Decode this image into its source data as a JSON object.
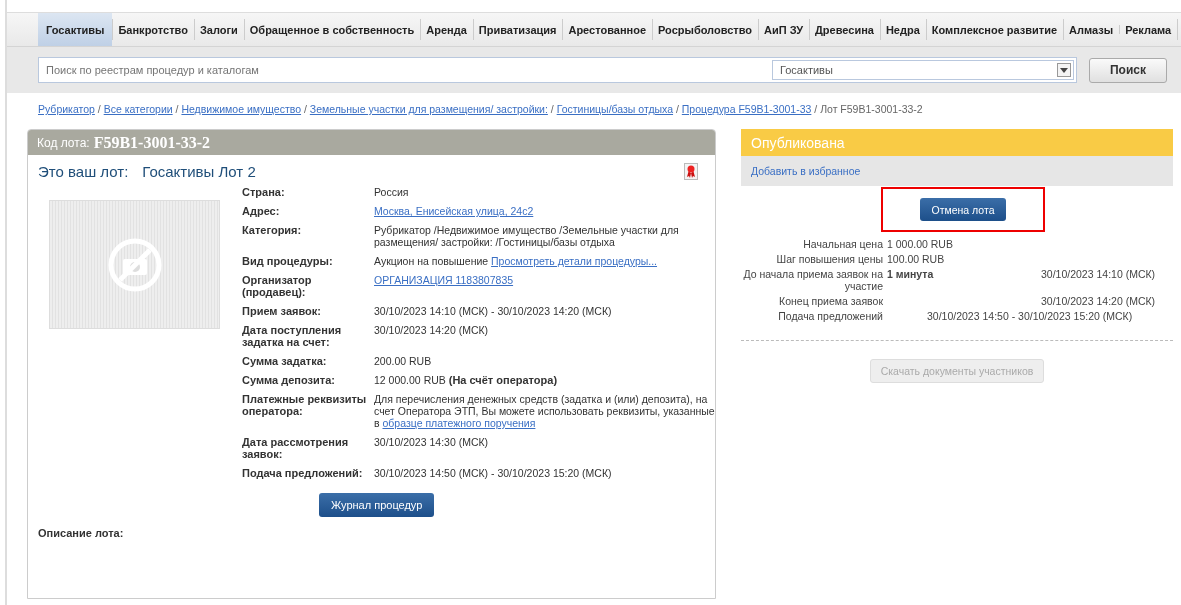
{
  "tabs": [
    {
      "label": "Госактивы",
      "selected": true
    },
    {
      "label": "Банкротство",
      "selected": false
    },
    {
      "label": "Залоги",
      "selected": false
    },
    {
      "label": "Обращенное в собственность",
      "selected": false
    },
    {
      "label": "Аренда",
      "selected": false
    },
    {
      "label": "Приватизация",
      "selected": false
    },
    {
      "label": "Арестованное",
      "selected": false
    },
    {
      "label": "Росрыболовство",
      "selected": false
    },
    {
      "label": "АиП ЗУ",
      "selected": false
    },
    {
      "label": "Древесина",
      "selected": false
    },
    {
      "label": "Недра",
      "selected": false
    },
    {
      "label": "Комплексное развитие",
      "selected": false
    },
    {
      "label": "Алмазы",
      "selected": false
    },
    {
      "label": "Реклама",
      "selected": false
    }
  ],
  "search": {
    "placeholder": "Поиск по реестрам процедур и каталогам",
    "category": "Госактивы",
    "button": "Поиск"
  },
  "breadcrumb_separator": "/",
  "breadcrumb": [
    {
      "text": "Рубрикатор",
      "kind": "link"
    },
    {
      "text": "Все категории",
      "kind": "link"
    },
    {
      "text": "Недвижимое имущество",
      "kind": "link"
    },
    {
      "text": "Земельные участки для размещения/ застройки:",
      "kind": "link"
    },
    {
      "text": "Гостиницы/базы отдыха",
      "kind": "link"
    },
    {
      "text": "Процедура F59B1-3001-33",
      "kind": "link"
    },
    {
      "text": "Лот F59B1-3001-33-2",
      "kind": "current"
    }
  ],
  "lot": {
    "code_label": "Код лота:",
    "code": "F59B1-3001-33-2",
    "owner_label": "Это ваш лот:",
    "title": "Госактивы Лот 2",
    "fields": [
      {
        "label": "Страна:",
        "value": [
          {
            "text": "Россия",
            "kind": "text"
          }
        ]
      },
      {
        "label": "Адрес:",
        "value": [
          {
            "text": "Москва, Енисейская улица, 24с2",
            "kind": "link"
          }
        ]
      },
      {
        "label": "Категория:",
        "value": [
          {
            "text": "Рубрикатор /Недвижимое имущество /Земельные участки для размещения/ застройки: /Гостиницы/базы отдыха",
            "kind": "text"
          }
        ]
      },
      {
        "label": "Вид процедуры:",
        "value": [
          {
            "text": "Аукцион на повышение ",
            "kind": "text"
          },
          {
            "text": "Просмотреть детали процедуры...",
            "kind": "link"
          }
        ]
      },
      {
        "label": "Организатор (продавец):",
        "value": [
          {
            "text": "ОРГАНИЗАЦИЯ 1183807835",
            "kind": "link"
          }
        ]
      },
      {
        "label": "Прием заявок:",
        "value": [
          {
            "text": "30/10/2023 14:10 (МСК) - 30/10/2023 14:20 (МСК)",
            "kind": "text"
          }
        ]
      },
      {
        "label": "Дата поступления задатка на счет:",
        "value": [
          {
            "text": "30/10/2023 14:20 (МСК)",
            "kind": "text"
          }
        ]
      },
      {
        "label": "Сумма задатка:",
        "value": [
          {
            "text": "200.00 RUB",
            "kind": "text"
          }
        ]
      },
      {
        "label": "Сумма депозита:",
        "value": [
          {
            "text": "12 000.00 RUB ",
            "kind": "text"
          },
          {
            "text": "(На счёт оператора)",
            "kind": "bold"
          }
        ]
      },
      {
        "label": "Платежные реквизиты оператора:",
        "value": [
          {
            "text": "Для перечисления денежных средств (задатка и (или) депозита), на счет Оператора ЭТП, Вы можете использовать реквизиты, указанные в ",
            "kind": "text"
          },
          {
            "text": "образце платежного поручения",
            "kind": "link"
          }
        ]
      },
      {
        "label": "Дата рассмотрения заявок:",
        "value": [
          {
            "text": "30/10/2023 14:30 (МСК)",
            "kind": "text"
          }
        ]
      },
      {
        "label": "Подача предложений:",
        "value": [
          {
            "text": "30/10/2023 14:50 (МСК) - 30/10/2023 15:20 (МСК)",
            "kind": "text"
          }
        ]
      }
    ],
    "journal_button": "Журнал процедур",
    "description_label": "Описание лота:"
  },
  "status": {
    "label": "Опубликована",
    "favorite_link": "Добавить в избранное",
    "cancel_button": "Отмена лота",
    "cancel_highlighted": true,
    "info": [
      {
        "kind": "value",
        "label": "Начальная цена",
        "value": "1 000.00 RUB"
      },
      {
        "kind": "value",
        "label": "Шаг повышения цены",
        "value": "100.00 RUB"
      },
      {
        "kind": "countdown",
        "label": "До начала приема заявок на участие",
        "value": "1 минута",
        "date": "30/10/2023 14:10 (МСК)"
      },
      {
        "kind": "date",
        "label": "Конец приема заявок",
        "date": "30/10/2023 14:20 (МСК)"
      },
      {
        "kind": "range",
        "label": "Подача предложений",
        "date": "30/10/2023 14:50 - 30/10/2023 15:20 (МСК)"
      }
    ],
    "download_button": "Скачать документы участников",
    "download_disabled": true
  }
}
